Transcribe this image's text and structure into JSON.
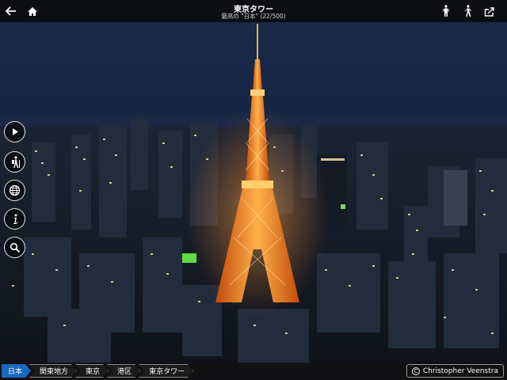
{
  "header": {
    "title": "東京タワー",
    "subtitle": "最高の \"日本\" (22/500)"
  },
  "toolbar": {
    "left_icons": [
      "back-arrow-icon",
      "home-icon"
    ],
    "right_icons": [
      "standing-figure-icon",
      "walking-figure-icon",
      "share-icon"
    ]
  },
  "side_buttons": [
    "play-icon",
    "hiker-icon",
    "globe-icon",
    "info-icon",
    "search-icon"
  ],
  "breadcrumb": [
    "日本",
    "関東地方",
    "東京",
    "港区",
    "東京タワー"
  ],
  "credit": {
    "symbol": "C",
    "name": "Christopher Veenstra"
  },
  "colors": {
    "breadcrumb_active": "#1769c2",
    "tower": "#ff7a1a",
    "sky": "#162545"
  }
}
